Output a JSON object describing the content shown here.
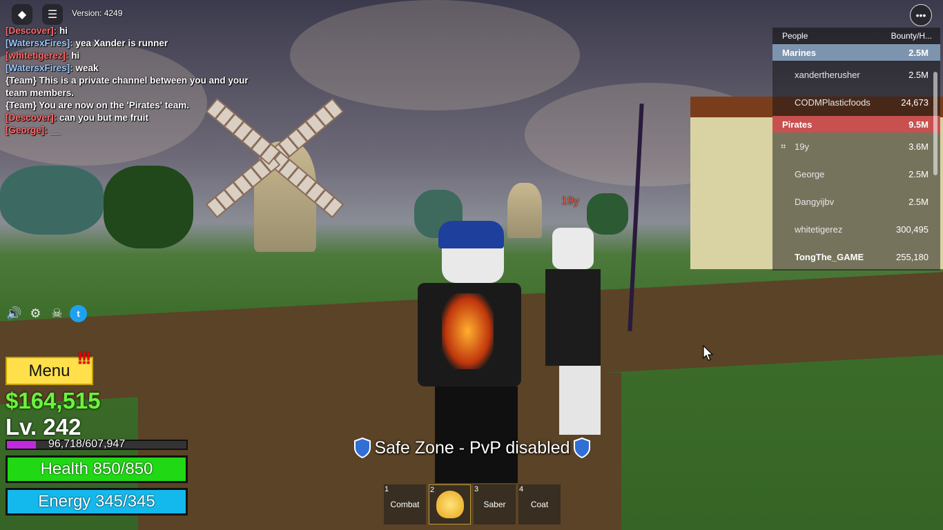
{
  "top_bar": {
    "roblox_icon": "roblox-logo-icon",
    "chat_icon": "chat-icon",
    "version": "Version: 4249",
    "more_icon": "more-options-icon"
  },
  "chat": [
    {
      "name": "[Descover]:",
      "name_color": "#ff6b6b",
      "text": " hi"
    },
    {
      "name": "[WatersxFires]:",
      "name_color": "#9ec9ff",
      "text": " yea Xander is runner"
    },
    {
      "name": "[whitetigerez]:",
      "name_color": "#ff6b6b",
      "text": " hi"
    },
    {
      "name": "[WatersxFires]:",
      "name_color": "#9ec9ff",
      "text": " weak"
    },
    {
      "name": "",
      "name_color": "#ffffff",
      "text": "{Team} This is a private channel between you and your team members."
    },
    {
      "name": "",
      "name_color": "#ffffff",
      "text": "{Team} You are now on the 'Pirates' team."
    },
    {
      "name": "[Descover]:",
      "name_color": "#ff6b6b",
      "text": " can you but me fruit"
    },
    {
      "name": "[George]:",
      "name_color": "#ff6b6b",
      "text": " __"
    }
  ],
  "leaderboard": {
    "col_people": "People",
    "col_bounty": "Bounty/H...",
    "marines": {
      "name": "Marines",
      "value": "2.5M",
      "color": "#7d94ae"
    },
    "marine_players": [
      {
        "name": "xandertherusher",
        "value": "2.5M"
      },
      {
        "name": "CODMPlasticfoods",
        "value": "24,673"
      }
    ],
    "pirates": {
      "name": "Pirates",
      "value": "9.5M",
      "color": "#c8504f"
    },
    "pirate_players": [
      {
        "name": "19y",
        "value": "3.6M",
        "badge": "premium-icon"
      },
      {
        "name": "George",
        "value": "2.5M"
      },
      {
        "name": "Dangyijbv",
        "value": "2.5M"
      },
      {
        "name": "whitetigerez",
        "value": "300,495"
      },
      {
        "name": "TongThe_GAME",
        "value": "255,180",
        "self": true
      }
    ]
  },
  "side_icons": [
    "speaker-icon",
    "gear-icon",
    "crossbones-icon",
    "twitter-icon"
  ],
  "hud": {
    "menu_label": "Menu",
    "alert": "!!!",
    "money": "$164,515",
    "level": "Lv. 242",
    "xp_text": "96,718/607,947",
    "xp_fraction": 0.16,
    "health_text": "Health 850/850",
    "energy_text": "Energy 345/345"
  },
  "safe_zone": "Safe Zone - PvP disabled",
  "hotbar": [
    {
      "num": "1",
      "label": "Combat"
    },
    {
      "num": "2",
      "label": "",
      "icon": "buddha-fruit-icon",
      "active": true
    },
    {
      "num": "3",
      "label": "Saber"
    },
    {
      "num": "4",
      "label": "Coat"
    }
  ],
  "world": {
    "player_tag": "19y"
  }
}
